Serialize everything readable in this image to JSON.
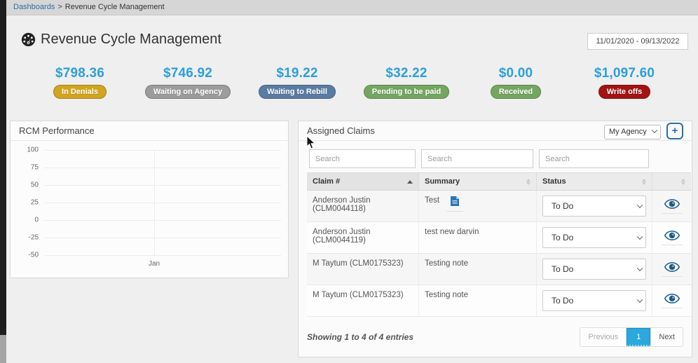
{
  "breadcrumb": {
    "link": "Dashboards",
    "separator": ">",
    "current": "Revenue Cycle Management"
  },
  "header": {
    "title": "Revenue Cycle Management",
    "date_range": "11/01/2020 - 09/13/2022"
  },
  "kpis": [
    {
      "value": "$798.36",
      "label": "In Denials",
      "color": "#d2a41f"
    },
    {
      "value": "$746.92",
      "label": "Waiting on Agency",
      "color": "#9c9c9c"
    },
    {
      "value": "$19.22",
      "label": "Waiting to Rebill",
      "color": "#5a7ca3"
    },
    {
      "value": "$32.22",
      "label": "Pending to be paid",
      "color": "#74a662"
    },
    {
      "value": "$0.00",
      "label": "Received",
      "color": "#74a662"
    },
    {
      "value": "$1,097.60",
      "label": "Write offs",
      "color": "#a31313"
    }
  ],
  "rcm_panel": {
    "title": "RCM Performance"
  },
  "chart_data": {
    "type": "line",
    "title": "RCM Performance",
    "x": [
      "Jan"
    ],
    "series": [],
    "note": "chart axes rendered but no data series plotted",
    "yticks": [
      "100",
      "75",
      "50",
      "25",
      "0",
      "-25",
      "-50"
    ],
    "ylim": [
      -50,
      100
    ],
    "xlabel": "",
    "ylabel": "",
    "grid": true,
    "legend": false
  },
  "assigned_claims": {
    "title": "Assigned Claims",
    "agency_select_value": "My Agency",
    "add_button_label": "+",
    "search_placeholder": "Search",
    "columns": {
      "claim": "Claim #",
      "summary": "Summary",
      "status": "Status",
      "actions": ""
    },
    "rows": [
      {
        "claim": "Anderson Justin (CLM0044118)",
        "summary": "Test",
        "status": "To Do"
      },
      {
        "claim": "Anderson Justin (CLM0044119)",
        "summary": "test new darvin",
        "status": "To Do"
      },
      {
        "claim": "M Taytum (CLM0175323)",
        "summary": "Testing note",
        "status": "To Do"
      },
      {
        "claim": "M Taytum (CLM0175323)",
        "summary": "Testing note",
        "status": "To Do"
      }
    ],
    "footer": {
      "showing": "Showing 1 to 4 of 4 entries",
      "previous": "Previous",
      "page": "1",
      "next": "Next"
    }
  },
  "colors": {
    "kpi_value_blue": "#2d9fd9",
    "link_blue": "#2e6da4",
    "eye_icon_blue": "#1d5a8c",
    "doc_icon_blue": "#2a76b8",
    "pagination_active": "#2ba9dc"
  }
}
